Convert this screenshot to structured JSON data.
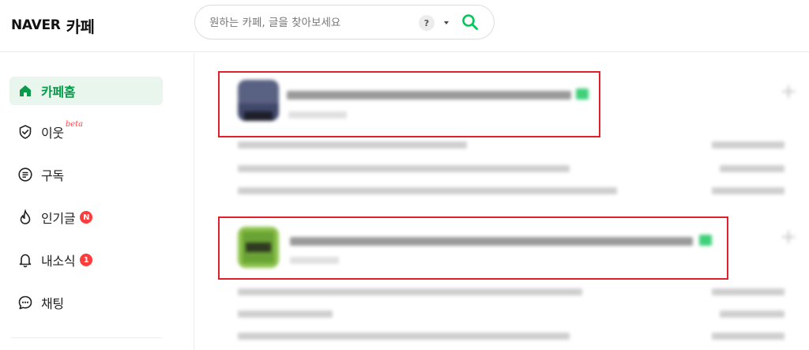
{
  "header": {
    "logo_naver": "NAVER",
    "logo_cafe": "카페",
    "search_placeholder": "원하는 카페, 글을 찾아보세요",
    "help_label": "?"
  },
  "sidebar": {
    "items": [
      {
        "label": "카페홈",
        "icon": "home-icon",
        "active": true
      },
      {
        "label": "이웃",
        "icon": "neighbor-check-icon",
        "tag": "beta"
      },
      {
        "label": "구독",
        "icon": "subscribe-icon"
      },
      {
        "label": "인기글",
        "icon": "flame-icon",
        "badge": "N"
      },
      {
        "label": "내소식",
        "icon": "bell-icon",
        "badge": "1"
      },
      {
        "label": "채팅",
        "icon": "chat-icon"
      }
    ]
  },
  "colors": {
    "accent": "#079b4a",
    "active_bg": "#e8f6ee",
    "badge": "#ff3b3b",
    "highlight": "#e0202a",
    "tag_green": "#3fd07a"
  }
}
